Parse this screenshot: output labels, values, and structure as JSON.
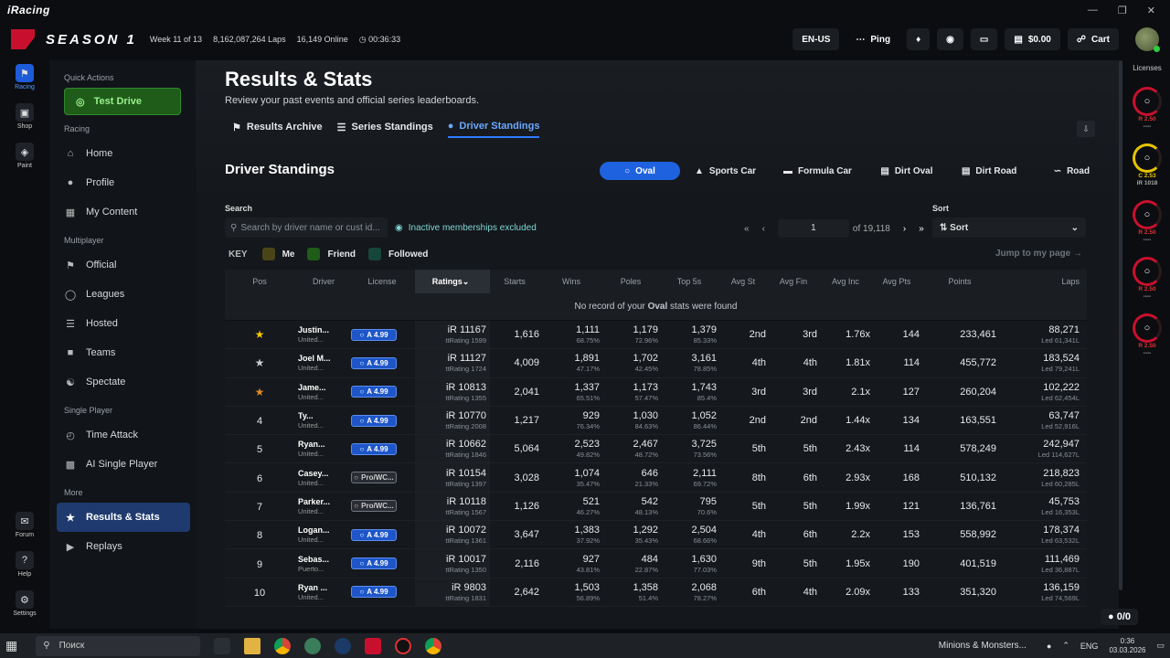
{
  "window": {
    "brand": "iRacing"
  },
  "topbar": {
    "season": "SEASON 1",
    "week": "Week 11 of 13",
    "laps": "8,162,087,264 Laps",
    "online": "16,149 Online",
    "timer": "00:36:33",
    "lang": "EN-US",
    "ping": "Ping",
    "wallet": "$0.00",
    "cart": "Cart"
  },
  "rail": [
    {
      "label": "Racing",
      "icon": "flag-icon"
    },
    {
      "label": "Shop",
      "icon": "bag-icon"
    },
    {
      "label": "Paint",
      "icon": "palette-icon"
    }
  ],
  "rail_bottom": [
    {
      "label": "Forum",
      "icon": "chat-icon"
    },
    {
      "label": "Help",
      "icon": "help-icon"
    },
    {
      "label": "Settings",
      "icon": "gear-icon"
    }
  ],
  "sidebar": {
    "quick": "Quick Actions",
    "test_drive": "Test Drive",
    "racing": "Racing",
    "racing_items": [
      "Home",
      "Profile",
      "My Content"
    ],
    "multiplayer": "Multiplayer",
    "mp_items": [
      "Official",
      "Leagues",
      "Hosted",
      "Teams",
      "Spectate"
    ],
    "single": "Single Player",
    "sp_items": [
      "Time Attack",
      "AI Single Player"
    ],
    "more": "More",
    "more_items": [
      "Results & Stats",
      "Replays"
    ]
  },
  "page": {
    "title": "Results & Stats",
    "subtitle": "Review your past events and official series leaderboards.",
    "tabs": [
      "Results Archive",
      "Series Standings",
      "Driver Standings"
    ],
    "section": "Driver Standings",
    "categories": [
      "Oval",
      "Sports Car",
      "Formula Car",
      "Dirt Oval",
      "Dirt Road",
      "Road"
    ],
    "search_label": "Search",
    "search_placeholder": "Search by driver name or cust id...",
    "inactive": "Inactive memberships excluded",
    "page_num": "1",
    "page_total": "of 19,118",
    "sort_label": "Sort",
    "sort_value": "Sort",
    "key_label": "KEY",
    "key_items": [
      "Me",
      "Friend",
      "Followed"
    ],
    "jump": "Jump to my page",
    "no_record_pre": "No record of your ",
    "no_record_cat": "Oval",
    "no_record_post": " stats were found"
  },
  "columns": [
    "Pos",
    "Driver",
    "License",
    "Ratings",
    "Starts",
    "Wins",
    "Poles",
    "Top 5s",
    "Avg St",
    "Avg Fin",
    "Avg Inc",
    "Avg Pts",
    "Points",
    "Laps"
  ],
  "rows": [
    {
      "pos": "",
      "trophy": "gold",
      "name": "Justin...",
      "country": "United...",
      "lic": "A 4.99",
      "lictype": "a",
      "ir": "iR 11167",
      "tt": "ttRating 1599",
      "starts": "1,616",
      "wins": "1,111",
      "winp": "68.75%",
      "poles": "1,179",
      "polep": "72.96%",
      "top5": "1,379",
      "top5p": "85.33%",
      "avgst": "2nd",
      "avgfin": "3rd",
      "inc": "1.76x",
      "pts": "144",
      "points": "233,461",
      "laps": "88,271",
      "led": "Led 61,341L"
    },
    {
      "pos": "",
      "trophy": "silver",
      "name": "Joel M...",
      "country": "United...",
      "lic": "A 4.99",
      "lictype": "a",
      "ir": "iR 11127",
      "tt": "ttRating 1724",
      "starts": "4,009",
      "wins": "1,891",
      "winp": "47.17%",
      "poles": "1,702",
      "polep": "42.45%",
      "top5": "3,161",
      "top5p": "78.85%",
      "avgst": "4th",
      "avgfin": "4th",
      "inc": "1.81x",
      "pts": "114",
      "points": "455,772",
      "laps": "183,524",
      "led": "Led 79,241L"
    },
    {
      "pos": "",
      "trophy": "bronze",
      "name": "Jame...",
      "country": "United...",
      "lic": "A 4.99",
      "lictype": "a",
      "ir": "iR 10813",
      "tt": "ttRating 1355",
      "starts": "2,041",
      "wins": "1,337",
      "winp": "65.51%",
      "poles": "1,173",
      "polep": "57.47%",
      "top5": "1,743",
      "top5p": "85.4%",
      "avgst": "3rd",
      "avgfin": "3rd",
      "inc": "2.1x",
      "pts": "127",
      "points": "260,204",
      "laps": "102,222",
      "led": "Led 62,454L"
    },
    {
      "pos": "4",
      "trophy": "",
      "name": "Ty...",
      "country": "United...",
      "lic": "A 4.99",
      "lictype": "a",
      "ir": "iR 10770",
      "tt": "ttRating 2008",
      "starts": "1,217",
      "wins": "929",
      "winp": "76.34%",
      "poles": "1,030",
      "polep": "84.63%",
      "top5": "1,052",
      "top5p": "86.44%",
      "avgst": "2nd",
      "avgfin": "2nd",
      "inc": "1.44x",
      "pts": "134",
      "points": "163,551",
      "laps": "63,747",
      "led": "Led 52,916L"
    },
    {
      "pos": "5",
      "trophy": "",
      "name": "Ryan...",
      "country": "United...",
      "lic": "A 4.99",
      "lictype": "a",
      "ir": "iR 10662",
      "tt": "ttRating 1846",
      "starts": "5,064",
      "wins": "2,523",
      "winp": "49.82%",
      "poles": "2,467",
      "polep": "48.72%",
      "top5": "3,725",
      "top5p": "73.56%",
      "avgst": "5th",
      "avgfin": "5th",
      "inc": "2.43x",
      "pts": "114",
      "points": "578,249",
      "laps": "242,947",
      "led": "Led 114,627L"
    },
    {
      "pos": "6",
      "trophy": "",
      "name": "Casey...",
      "country": "United...",
      "lic": "Pro/WC...",
      "lictype": "p",
      "ir": "iR 10154",
      "tt": "ttRating 1397",
      "starts": "3,028",
      "wins": "1,074",
      "winp": "35.47%",
      "poles": "646",
      "polep": "21.33%",
      "top5": "2,111",
      "top5p": "69.72%",
      "avgst": "8th",
      "avgfin": "6th",
      "inc": "2.93x",
      "pts": "168",
      "points": "510,132",
      "laps": "218,823",
      "led": "Led 60,285L"
    },
    {
      "pos": "7",
      "trophy": "",
      "name": "Parker...",
      "country": "United...",
      "lic": "Pro/WC...",
      "lictype": "p",
      "ir": "iR 10118",
      "tt": "ttRating 1567",
      "starts": "1,126",
      "wins": "521",
      "winp": "46.27%",
      "poles": "542",
      "polep": "48.13%",
      "top5": "795",
      "top5p": "70.6%",
      "avgst": "5th",
      "avgfin": "5th",
      "inc": "1.99x",
      "pts": "121",
      "points": "136,761",
      "laps": "45,753",
      "led": "Led 16,353L"
    },
    {
      "pos": "8",
      "trophy": "",
      "name": "Logan...",
      "country": "United...",
      "lic": "A 4.99",
      "lictype": "a",
      "ir": "iR 10072",
      "tt": "ttRating 1361",
      "starts": "3,647",
      "wins": "1,383",
      "winp": "37.92%",
      "poles": "1,292",
      "polep": "35.43%",
      "top5": "2,504",
      "top5p": "68.66%",
      "avgst": "4th",
      "avgfin": "6th",
      "inc": "2.2x",
      "pts": "153",
      "points": "558,992",
      "laps": "178,374",
      "led": "Led 63,532L"
    },
    {
      "pos": "9",
      "trophy": "",
      "name": "Sebas...",
      "country": "Puerto...",
      "lic": "A 4.99",
      "lictype": "a",
      "ir": "iR 10017",
      "tt": "ttRating 1350",
      "starts": "2,116",
      "wins": "927",
      "winp": "43.81%",
      "poles": "484",
      "polep": "22.87%",
      "top5": "1,630",
      "top5p": "77.03%",
      "avgst": "9th",
      "avgfin": "5th",
      "inc": "1.95x",
      "pts": "190",
      "points": "401,519",
      "laps": "111,469",
      "led": "Led 36,887L"
    },
    {
      "pos": "10",
      "trophy": "",
      "name": "Ryan ...",
      "country": "United...",
      "lic": "A 4.99",
      "lictype": "a",
      "ir": "iR 9803",
      "tt": "ttRating 1831",
      "starts": "2,642",
      "wins": "1,503",
      "winp": "56.89%",
      "poles": "1,358",
      "polep": "51.4%",
      "top5": "2,068",
      "top5p": "78.27%",
      "avgst": "6th",
      "avgfin": "4th",
      "inc": "2.09x",
      "pts": "133",
      "points": "351,320",
      "laps": "136,159",
      "led": "Led 74,569L"
    }
  ],
  "licenses": {
    "title": "Licenses",
    "items": [
      {
        "icon": "oval-icon",
        "r": "R 2.50",
        "sub": "----",
        "color": "#c8102e"
      },
      {
        "icon": "car-icon",
        "r": "C 2.53",
        "sub": "iR 1018",
        "color": "#e6c400"
      },
      {
        "icon": "formula-icon",
        "r": "R 2.50",
        "sub": "----",
        "color": "#c8102e"
      },
      {
        "icon": "dirt-oval-icon",
        "r": "R 2.50",
        "sub": "----",
        "color": "#c8102e"
      },
      {
        "icon": "dirt-road-icon",
        "r": "R 2.50",
        "sub": "----",
        "color": "#c8102e"
      }
    ]
  },
  "chat": "0/0",
  "taskbar": {
    "search": "Поиск",
    "media": "Minions & Monsters...",
    "lang": "ENG",
    "time": "0:36",
    "date": "03.03.2026"
  }
}
